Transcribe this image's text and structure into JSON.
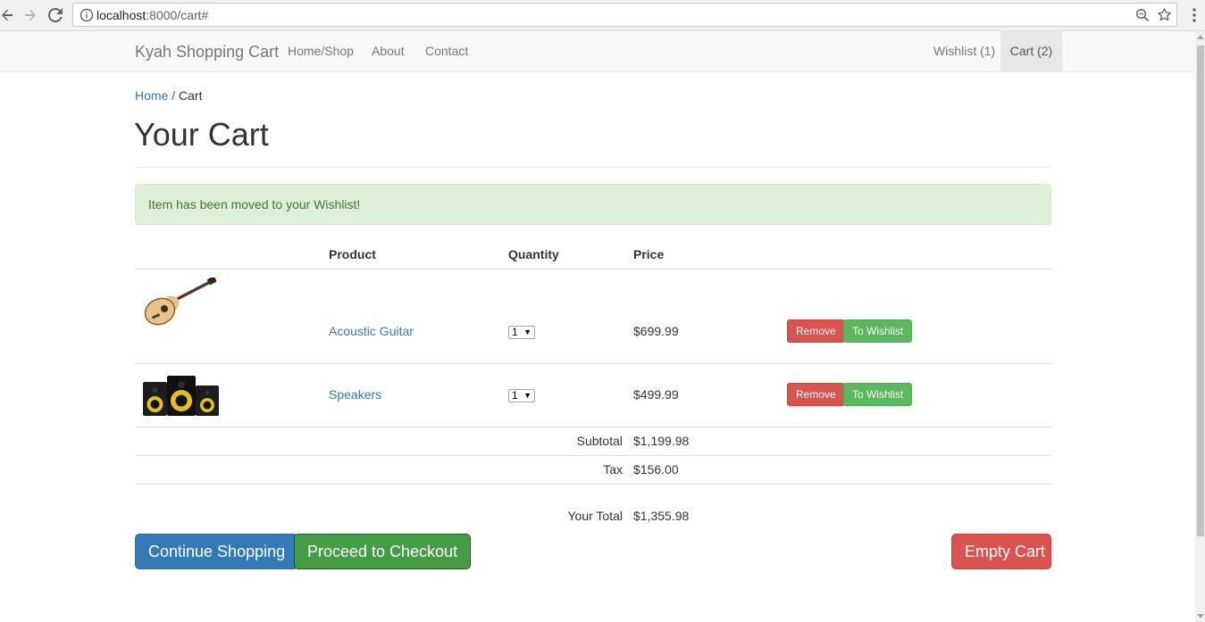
{
  "browser": {
    "url_host": "localhost",
    "url_rest": ":8000/cart#"
  },
  "navbar": {
    "brand": "Kyah Shopping Cart",
    "links": [
      {
        "label": "Home/Shop"
      },
      {
        "label": "About"
      },
      {
        "label": "Contact"
      }
    ],
    "right_links": [
      {
        "label": "Wishlist (1)"
      },
      {
        "label": "Cart (2)"
      }
    ]
  },
  "breadcrumb": {
    "home": "Home",
    "separator": "/",
    "current": "Cart"
  },
  "page": {
    "title": "Your Cart"
  },
  "alert": {
    "message": "Item has been moved to your Wishlist!"
  },
  "table": {
    "headers": {
      "product": "Product",
      "quantity": "Quantity",
      "price": "Price"
    },
    "rows": [
      {
        "product": "Acoustic Guitar",
        "quantity": "1",
        "price": "$699.99",
        "remove_label": "Remove",
        "wishlist_label": "To Wishlist",
        "image_icon": "acoustic-guitar-image"
      },
      {
        "product": "Speakers",
        "quantity": "1",
        "price": "$499.99",
        "remove_label": "Remove",
        "wishlist_label": "To Wishlist",
        "image_icon": "speakers-image"
      }
    ],
    "summary": {
      "subtotal_label": "Subtotal",
      "subtotal_value": "$1,199.98",
      "tax_label": "Tax",
      "tax_value": "$156.00",
      "total_label": "Your Total",
      "total_value": "$1,355.98"
    }
  },
  "actions": {
    "continue_label": "Continue Shopping",
    "checkout_label": "Proceed to Checkout",
    "empty_label": "Empty Cart"
  },
  "colors": {
    "link": "#337ab7",
    "danger": "#d9534f",
    "success": "#5cb85c",
    "primary": "#337ab7",
    "alert_bg": "#dff0d8",
    "alert_text": "#3c763d"
  }
}
